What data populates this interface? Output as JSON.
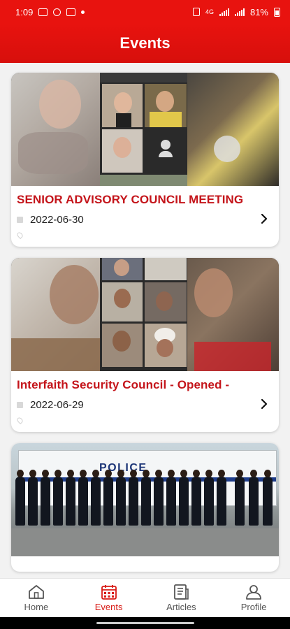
{
  "status_bar": {
    "time": "1:09",
    "network": "4G",
    "battery": "81%"
  },
  "header": {
    "title": "Events"
  },
  "events": [
    {
      "title": "SENIOR ADVISORY COUNCIL MEETING",
      "date": "2022-06-30",
      "location": ""
    },
    {
      "title": "Interfaith Security Council - Opened -",
      "date": "2022-06-29",
      "location": ""
    },
    {
      "title": "",
      "date": "",
      "image_text": "POLICE"
    }
  ],
  "bottom_nav": {
    "items": [
      {
        "label": "Home",
        "icon": "home-icon",
        "active": false
      },
      {
        "label": "Events",
        "icon": "calendar-icon",
        "active": true
      },
      {
        "label": "Articles",
        "icon": "articles-icon",
        "active": false
      },
      {
        "label": "Profile",
        "icon": "profile-icon",
        "active": false
      }
    ]
  },
  "colors": {
    "primary": "#e8130f",
    "title_red": "#c4141a",
    "active_nav": "#d81b16"
  }
}
